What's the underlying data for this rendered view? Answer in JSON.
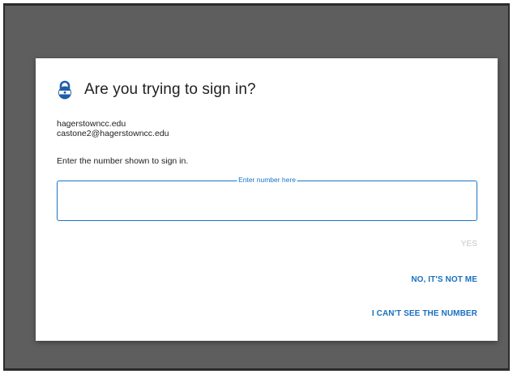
{
  "dialog": {
    "title": "Are you trying to sign in?",
    "icon": "lock-icon",
    "account": {
      "domain": "hagerstowncc.edu",
      "email": "castone2@hagerstowncc.edu"
    },
    "instruction": "Enter the number shown to sign in.",
    "number_field": {
      "label": "Enter number here",
      "value": ""
    },
    "actions": {
      "yes": "YES",
      "not_me": "NO, IT'S NOT ME",
      "cant_see": "I CAN'T SEE THE NUMBER"
    }
  },
  "colors": {
    "accent": "#1a73c8",
    "icon_blue": "#1f5fa8",
    "disabled": "#c7c7c7",
    "backdrop": "#5e5e5e"
  }
}
